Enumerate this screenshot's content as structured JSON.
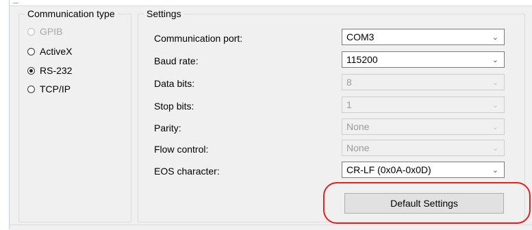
{
  "communication_type": {
    "title": "Communication type",
    "options": [
      {
        "label": "GPIB",
        "selected": false,
        "disabled": true
      },
      {
        "label": "ActiveX",
        "selected": false,
        "disabled": false
      },
      {
        "label": "RS-232",
        "selected": true,
        "disabled": false
      },
      {
        "label": "TCP/IP",
        "selected": false,
        "disabled": false
      }
    ]
  },
  "settings": {
    "title": "Settings",
    "rows": [
      {
        "label": "Communication port:",
        "value": "COM3",
        "enabled": true
      },
      {
        "label": "Baud rate:",
        "value": "115200",
        "enabled": true
      },
      {
        "label": "Data bits:",
        "value": "8",
        "enabled": false
      },
      {
        "label": "Stop bits:",
        "value": "1",
        "enabled": false
      },
      {
        "label": "Parity:",
        "value": "None",
        "enabled": false
      },
      {
        "label": "Flow control:",
        "value": "None",
        "enabled": false
      },
      {
        "label": "EOS character:",
        "value": "CR-LF (0x0A-0x0D)",
        "enabled": true
      }
    ],
    "default_button": "Default Settings"
  },
  "icons": {
    "dropdown": "chevron-down-icon",
    "radio": "radio-icon"
  },
  "colors": {
    "highlight": "#e0201b",
    "panel_bg": "#f0f0f0",
    "disabled_text": "#a7a7a7"
  }
}
